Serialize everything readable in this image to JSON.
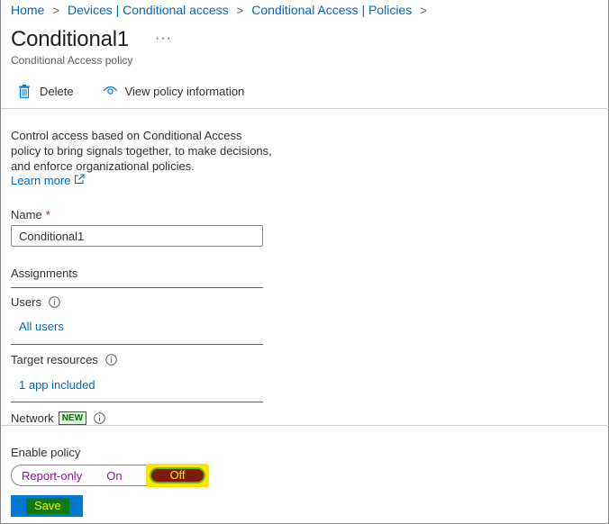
{
  "breadcrumb": {
    "items": [
      "Home",
      "Devices | Conditional access",
      "Conditional Access | Policies"
    ],
    "separator": ">"
  },
  "header": {
    "title": "Conditional1",
    "subtitle": "Conditional Access policy",
    "more_label": "···"
  },
  "toolbar": {
    "delete_label": "Delete",
    "view_info_label": "View policy information"
  },
  "description": {
    "text": "Control access based on Conditional Access policy to bring signals together, to make decisions, and enforce organizational policies.",
    "learn_more": "Learn more"
  },
  "form": {
    "name_label": "Name",
    "required_marker": "*",
    "name_value": "Conditional1",
    "assignments_title": "Assignments",
    "users_label": "Users",
    "users_value": "All users",
    "target_label": "Target resources",
    "target_value": "1 app included",
    "network_label": "Network",
    "network_badge": "NEW"
  },
  "footer": {
    "enable_label": "Enable policy",
    "options": [
      "Report-only",
      "On",
      "Off"
    ],
    "selected_option": "Off",
    "save_label": "Save"
  },
  "colors": {
    "link": "#0067b8",
    "accent": "#0078d4",
    "toggle_text": "#881798",
    "highlight": "#ffe600",
    "save_label_bg": "#107c10",
    "off_fill": "#7a1b0c"
  },
  "icons": {
    "delete": "trash-icon",
    "view": "eye-icon",
    "external": "external-link-icon",
    "info": "info-icon",
    "more": "more-icon"
  }
}
